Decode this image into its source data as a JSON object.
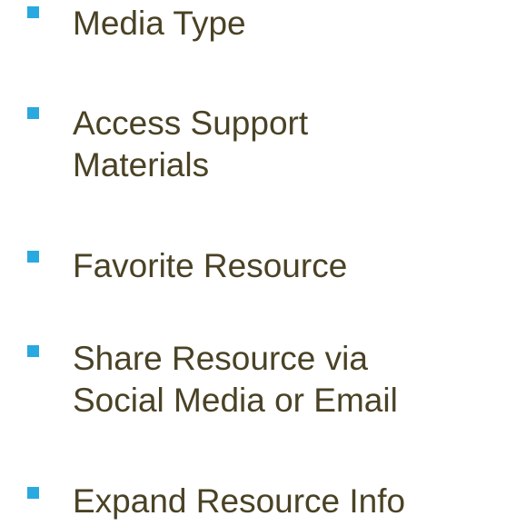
{
  "colors": {
    "bullet": "#29a9e0",
    "text": "#4a4225"
  },
  "bullets": [
    {
      "line1": "Media Type"
    },
    {
      "line1": "Access Support",
      "line2": "Materials"
    },
    {
      "line1": "Favorite Resource"
    },
    {
      "line1": "Share Resource via",
      "line2": "Social Media or Email"
    },
    {
      "line1": "Expand Resource Info"
    }
  ]
}
